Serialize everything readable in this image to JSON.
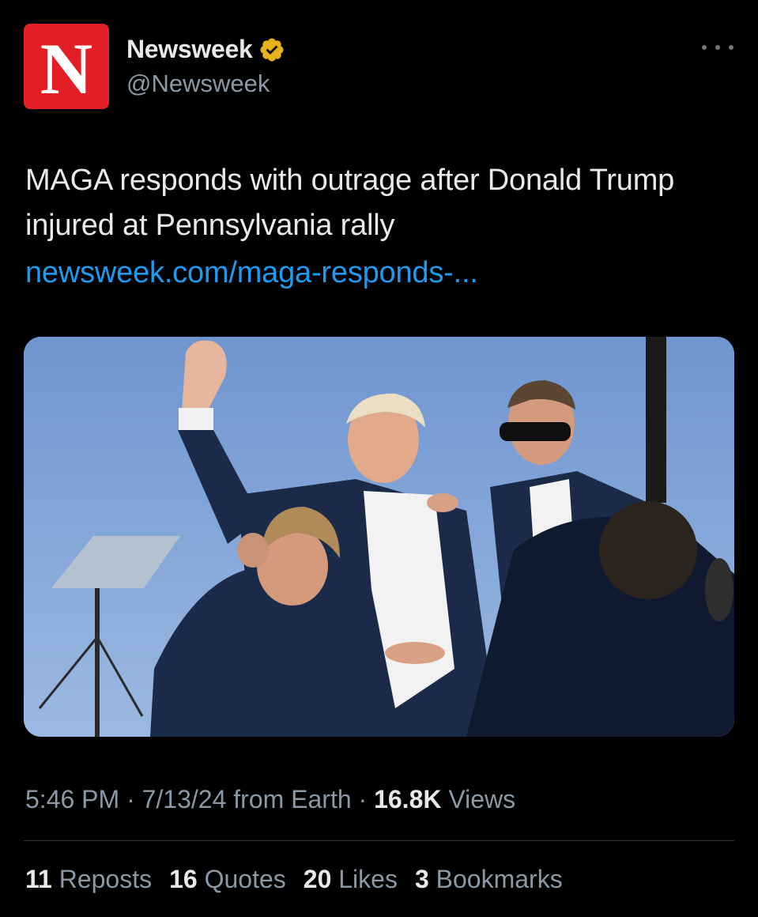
{
  "colors": {
    "background": "#000000",
    "avatar_bg": "#e31e26",
    "verified_badge": "#e8b21e",
    "link": "#1d9bf0",
    "secondary_text": "#8b98a5",
    "primary_text": "#e7e9ea"
  },
  "account": {
    "avatar_letter": "N",
    "display_name": "Newsweek",
    "handle": "@Newsweek",
    "verified_icon": "gold-verified-badge-icon",
    "more_icon": "more-options-icon"
  },
  "post": {
    "text": "MAGA responds with outrage after Donald Trump injured at Pennsylvania rally",
    "link": "newsweek.com/maga-responds-..."
  },
  "media": {
    "type": "photo"
  },
  "meta": {
    "time": "5:46 PM",
    "date": "7/13/24",
    "source": "from Earth",
    "separator": "·",
    "views_count": "16.8K",
    "views_label": "Views"
  },
  "stats": {
    "reposts_count": "11",
    "reposts_label": "Reposts",
    "quotes_count": "16",
    "quotes_label": "Quotes",
    "likes_count": "20",
    "likes_label": "Likes",
    "bookmarks_count": "3",
    "bookmarks_label": "Bookmarks"
  }
}
